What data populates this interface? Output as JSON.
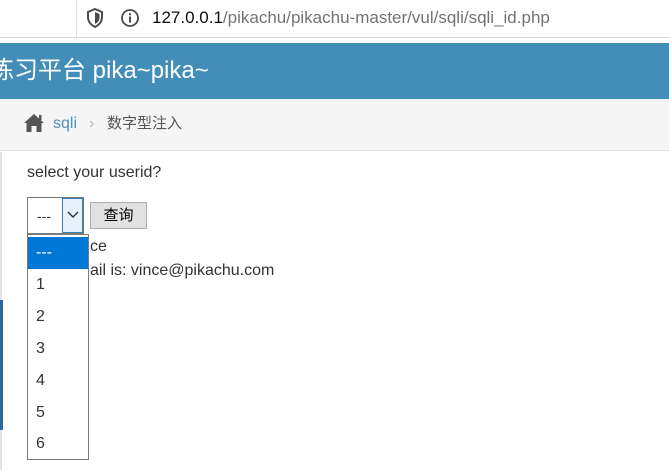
{
  "browser": {
    "url_host": "127.0.0.1",
    "url_path": "/pikachu/pikachu-master/vul/sqli/sqli_id.php",
    "icons": [
      "shield-icon",
      "info-icon"
    ]
  },
  "navbar": {
    "brand": "练习平台 pika~pika~"
  },
  "breadcrumb": {
    "link": "sqli",
    "separator": "›",
    "current": "数字型注入"
  },
  "form": {
    "prompt": "select your userid?",
    "selected_value": "---",
    "submit_label": "查询",
    "options": [
      "---",
      "1",
      "2",
      "3",
      "4",
      "5",
      "6"
    ]
  },
  "result": {
    "line1": "ce",
    "line2": "ail is: vince@pikachu.com"
  },
  "colors": {
    "navbar": "#438eb9",
    "link": "#4c8fbd",
    "selected_option": "#0078d7"
  }
}
